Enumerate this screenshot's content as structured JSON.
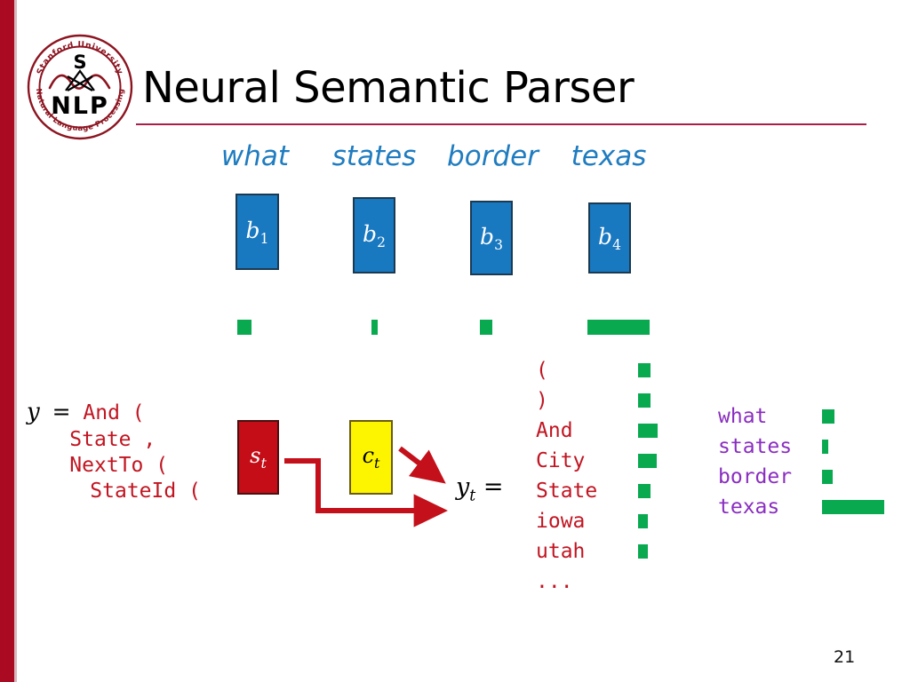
{
  "slide": {
    "title": "Neural Semantic Parser",
    "page_number": "21",
    "accent_color": "#a7204a",
    "sidebar_color": "#aa0a22"
  },
  "logo": {
    "name": "stanford-nlp-logo",
    "top_arc_text": "Stanford University",
    "bottom_arc_text": "Natural Language Processing",
    "center_top": "S",
    "center_bottom": "N L P",
    "color": "#8c1420"
  },
  "encoder": {
    "words": [
      "what",
      "states",
      "border",
      "texas"
    ],
    "word_color": "#1f7cc0",
    "hidden_states": [
      {
        "label": "b",
        "sub": "1"
      },
      {
        "label": "b",
        "sub": "2"
      },
      {
        "label": "b",
        "sub": "3"
      },
      {
        "label": "b",
        "sub": "4"
      }
    ],
    "box_color": "#1878c0",
    "attention_bar_color": "#09a950",
    "attention_bars": [
      {
        "for": "b1",
        "width": 16
      },
      {
        "for": "b2",
        "width": 7
      },
      {
        "for": "b3",
        "width": 14
      },
      {
        "for": "b4",
        "width": 70
      }
    ]
  },
  "logical_form": {
    "y_symbol": "y",
    "equals": "=",
    "lines": [
      "And (",
      "State ,",
      "NextTo (",
      "StateId ("
    ],
    "color": "#c11622"
  },
  "decoder": {
    "state_box": {
      "name": "s",
      "sub": "t",
      "fill": "#c40d16",
      "text_color": "#ffffff"
    },
    "context_box": {
      "name": "c",
      "sub": "t",
      "fill": "#fdf500",
      "text_color": "#000000"
    },
    "output_label": {
      "name": "y",
      "sub": "t",
      "equals": "="
    }
  },
  "vocabulary": {
    "tokens": [
      "(",
      ")",
      "And",
      "City",
      "State",
      "iowa",
      "utah",
      "..."
    ],
    "probability_bars": [
      14,
      14,
      22,
      21,
      14,
      11,
      11,
      0
    ],
    "token_color": "#c11622",
    "bar_color": "#09a950"
  },
  "attention_over_words": {
    "tokens": [
      "what",
      "states",
      "border",
      "texas"
    ],
    "probability_bars": [
      14,
      7,
      12,
      70
    ],
    "token_color": "#8a2ec0",
    "bar_color": "#09a950"
  }
}
